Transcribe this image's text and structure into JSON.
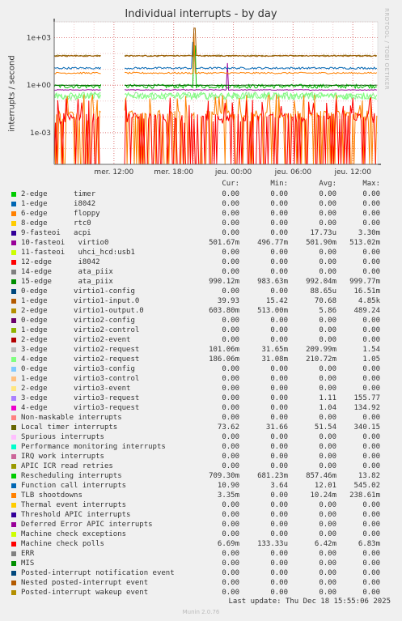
{
  "chart_data": {
    "type": "line",
    "title": "Individual interrupts - by day",
    "ylabel": "interrupts / second",
    "yscale": "log",
    "ylim": [
      1e-05,
      10000
    ],
    "yticks": [
      {
        "v": 1000,
        "label": "1e+03"
      },
      {
        "v": 1,
        "label": "1e+00"
      },
      {
        "v": 0.001,
        "label": "1e-03"
      }
    ],
    "xlim": [
      0,
      32.5
    ],
    "xticks": [
      {
        "v": 6,
        "label": "mer. 12:00"
      },
      {
        "v": 12,
        "label": "mer. 18:00"
      },
      {
        "v": 18,
        "label": "jeu. 00:00"
      },
      {
        "v": 24,
        "label": "jeu. 06:00"
      },
      {
        "v": 30,
        "label": "jeu. 12:00"
      }
    ],
    "grid": true,
    "gap": [
      4.8,
      7.0
    ],
    "series": [
      {
        "name": "Local timer interrupts",
        "color": "#8A6F14",
        "level": 73.62,
        "jitter": 0.07
      },
      {
        "name": "Rescheduling interrupts",
        "color": "#00C000",
        "level": 0.8575,
        "jitter": 0.25,
        "spike_at": 14.1,
        "spike": 300
      },
      {
        "name": "10-fasteoi virtio0",
        "color": "#9A009A",
        "level": 0.5019,
        "jitter": 0.04,
        "spike_at": 17.4,
        "spike": 25
      },
      {
        "name": "15-edge ata_piix",
        "color": "#006400",
        "level": 0.992,
        "jitter": 0.03
      },
      {
        "name": "Function call interrupts",
        "color": "#0066B3",
        "level": 12.01,
        "jitter": 0.12,
        "spike_at": 14.0,
        "spike": 500
      },
      {
        "name": "2-edge virtio1-output.0",
        "color": "#FF8000",
        "level": 5.86,
        "jitter": 0.1,
        "spike_at": 14.05,
        "spike": 2000
      },
      {
        "name": "1-edge virtio1-input.0",
        "color": "#A05A00",
        "level": 70.68,
        "jitter": 0.08,
        "spike_at": 14.1,
        "spike": 4000
      },
      {
        "name": "3-edge virtio2-request",
        "color": "#90EE90",
        "level": 0.21,
        "jitter": 0.5
      },
      {
        "name": "4-edge virtio2-request",
        "color": "#7FFF7F",
        "level": 0.2107,
        "jitter": 0.4
      },
      {
        "name": "TLB shootdowns",
        "color": "#FF8000",
        "level": 0.01024,
        "jitter": 2.5,
        "spiky": true
      },
      {
        "name": "Machine check polls",
        "color": "#FF0000",
        "level": 0.0068,
        "jitter": 0.1,
        "spiky": true
      }
    ]
  },
  "legend": {
    "headers": {
      "cur": "Cur:",
      "min": "Min:",
      "avg": "Avg:",
      "max": "Max:"
    },
    "rows": [
      {
        "label": "2-edge      timer",
        "color": "#00CC00",
        "cur": "0.00",
        "min": "0.00",
        "avg": "0.00",
        "max": "0.00"
      },
      {
        "label": "1-edge      i8042",
        "color": "#0066B3",
        "cur": "0.00",
        "min": "0.00",
        "avg": "0.00",
        "max": "0.00"
      },
      {
        "label": "6-edge      floppy",
        "color": "#FF8000",
        "cur": "0.00",
        "min": "0.00",
        "avg": "0.00",
        "max": "0.00"
      },
      {
        "label": "8-edge      rtc0",
        "color": "#FFCC00",
        "cur": "0.00",
        "min": "0.00",
        "avg": "0.00",
        "max": "0.00"
      },
      {
        "label": "9-fasteoi   acpi",
        "color": "#330099",
        "cur": "0.00",
        "min": "0.00",
        "avg": "17.73u",
        "max": "3.30m"
      },
      {
        "label": "10-fasteoi   virtio0",
        "color": "#990099",
        "cur": "501.67m",
        "min": "496.77m",
        "avg": "501.90m",
        "max": "513.02m"
      },
      {
        "label": "11-fasteoi   uhci_hcd:usb1",
        "color": "#CCFF00",
        "cur": "0.00",
        "min": "0.00",
        "avg": "0.00",
        "max": "0.00"
      },
      {
        "label": "12-edge      i8042",
        "color": "#FF0000",
        "cur": "0.00",
        "min": "0.00",
        "avg": "0.00",
        "max": "0.00"
      },
      {
        "label": "14-edge      ata_piix",
        "color": "#808080",
        "cur": "0.00",
        "min": "0.00",
        "avg": "0.00",
        "max": "0.00"
      },
      {
        "label": "15-edge      ata_piix",
        "color": "#008F00",
        "cur": "990.12m",
        "min": "983.63m",
        "avg": "992.04m",
        "max": "999.77m"
      },
      {
        "label": "0-edge      virtio1-config",
        "color": "#00487D",
        "cur": "0.00",
        "min": "0.00",
        "avg": "88.65u",
        "max": "16.51m"
      },
      {
        "label": "1-edge      virtio1-input.0",
        "color": "#B35A00",
        "cur": "39.93",
        "min": "15.42",
        "avg": "70.68",
        "max": "4.85k"
      },
      {
        "label": "2-edge      virtio1-output.0",
        "color": "#B38F00",
        "cur": "603.80m",
        "min": "513.00m",
        "avg": "5.86",
        "max": "489.24"
      },
      {
        "label": "0-edge      virtio2-config",
        "color": "#6B006B",
        "cur": "0.00",
        "min": "0.00",
        "avg": "0.00",
        "max": "0.00"
      },
      {
        "label": "1-edge      virtio2-control",
        "color": "#8FB300",
        "cur": "0.00",
        "min": "0.00",
        "avg": "0.00",
        "max": "0.00"
      },
      {
        "label": "2-edge      virtio2-event",
        "color": "#B30000",
        "cur": "0.00",
        "min": "0.00",
        "avg": "0.00",
        "max": "0.00"
      },
      {
        "label": "3-edge      virtio2-request",
        "color": "#BEBEBE",
        "cur": "101.06m",
        "min": "31.65m",
        "avg": "209.99m",
        "max": "1.54"
      },
      {
        "label": "4-edge      virtio2-request",
        "color": "#80FF80",
        "cur": "186.06m",
        "min": "31.08m",
        "avg": "210.72m",
        "max": "1.05"
      },
      {
        "label": "0-edge      virtio3-config",
        "color": "#80C9FF",
        "cur": "0.00",
        "min": "0.00",
        "avg": "0.00",
        "max": "0.00"
      },
      {
        "label": "1-edge      virtio3-control",
        "color": "#FFC080",
        "cur": "0.00",
        "min": "0.00",
        "avg": "0.00",
        "max": "0.00"
      },
      {
        "label": "2-edge      virtio3-event",
        "color": "#FFE680",
        "cur": "0.00",
        "min": "0.00",
        "avg": "0.00",
        "max": "0.00"
      },
      {
        "label": "3-edge      virtio3-request",
        "color": "#AA80FF",
        "cur": "0.00",
        "min": "0.00",
        "avg": "1.11",
        "max": "155.77"
      },
      {
        "label": "4-edge      virtio3-request",
        "color": "#EE00CC",
        "cur": "0.00",
        "min": "0.00",
        "avg": "1.04",
        "max": "134.92"
      },
      {
        "label": "Non-maskable interrupts",
        "color": "#FF8080",
        "cur": "0.00",
        "min": "0.00",
        "avg": "0.00",
        "max": "0.00"
      },
      {
        "label": "Local timer interrupts",
        "color": "#666600",
        "cur": "73.62",
        "min": "31.66",
        "avg": "51.54",
        "max": "340.15"
      },
      {
        "label": "Spurious interrupts",
        "color": "#FFBFFF",
        "cur": "0.00",
        "min": "0.00",
        "avg": "0.00",
        "max": "0.00"
      },
      {
        "label": "Performance monitoring interrupts",
        "color": "#00FFCC",
        "cur": "0.00",
        "min": "0.00",
        "avg": "0.00",
        "max": "0.00"
      },
      {
        "label": "IRQ work interrupts",
        "color": "#CC6699",
        "cur": "0.00",
        "min": "0.00",
        "avg": "0.00",
        "max": "0.00"
      },
      {
        "label": "APIC ICR read retries",
        "color": "#999900",
        "cur": "0.00",
        "min": "0.00",
        "avg": "0.00",
        "max": "0.00"
      },
      {
        "label": "Rescheduling interrupts",
        "color": "#00CC00",
        "cur": "709.30m",
        "min": "681.23m",
        "avg": "857.46m",
        "max": "13.82"
      },
      {
        "label": "Function call interrupts",
        "color": "#0066B3",
        "cur": "10.90",
        "min": "3.64",
        "avg": "12.01",
        "max": "545.02"
      },
      {
        "label": "TLB shootdowns",
        "color": "#FF8000",
        "cur": "3.35m",
        "min": "0.00",
        "avg": "10.24m",
        "max": "238.61m"
      },
      {
        "label": "Thermal event interrupts",
        "color": "#FFCC00",
        "cur": "0.00",
        "min": "0.00",
        "avg": "0.00",
        "max": "0.00"
      },
      {
        "label": "Threshold APIC interrupts",
        "color": "#330099",
        "cur": "0.00",
        "min": "0.00",
        "avg": "0.00",
        "max": "0.00"
      },
      {
        "label": "Deferred Error APIC interrupts",
        "color": "#990099",
        "cur": "0.00",
        "min": "0.00",
        "avg": "0.00",
        "max": "0.00"
      },
      {
        "label": "Machine check exceptions",
        "color": "#CCFF00",
        "cur": "0.00",
        "min": "0.00",
        "avg": "0.00",
        "max": "0.00"
      },
      {
        "label": "Machine check polls",
        "color": "#FF0000",
        "cur": "6.69m",
        "min": "133.33u",
        "avg": "6.42m",
        "max": "6.83m"
      },
      {
        "label": "ERR",
        "color": "#808080",
        "cur": "0.00",
        "min": "0.00",
        "avg": "0.00",
        "max": "0.00"
      },
      {
        "label": "MIS",
        "color": "#008F00",
        "cur": "0.00",
        "min": "0.00",
        "avg": "0.00",
        "max": "0.00"
      },
      {
        "label": "Posted-interrupt notification event",
        "color": "#00487D",
        "cur": "0.00",
        "min": "0.00",
        "avg": "0.00",
        "max": "0.00"
      },
      {
        "label": "Nested posted-interrupt event",
        "color": "#B35A00",
        "cur": "0.00",
        "min": "0.00",
        "avg": "0.00",
        "max": "0.00"
      },
      {
        "label": "Posted-interrupt wakeup event",
        "color": "#B38F00",
        "cur": "0.00",
        "min": "0.00",
        "avg": "0.00",
        "max": "0.00"
      }
    ]
  },
  "footer": {
    "last_update": "Last update: Thu Dec 18 15:55:06 2025",
    "munin": "Munin 2.0.76",
    "watermark": "RRDTOOL / TOBI OETIKER"
  }
}
